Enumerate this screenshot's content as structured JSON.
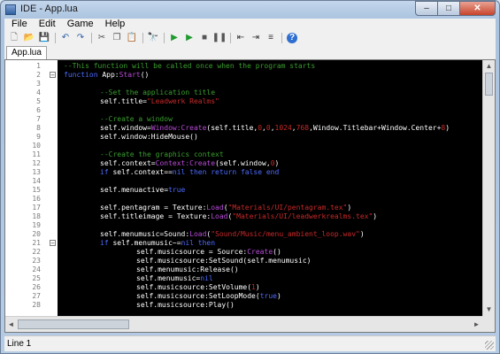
{
  "window": {
    "title": "IDE - App.lua"
  },
  "caption_buttons": {
    "minimize": "–",
    "maximize": "□",
    "close": "✕"
  },
  "menu": [
    "File",
    "Edit",
    "Game",
    "Help"
  ],
  "toolbar": [
    {
      "name": "new-file-icon",
      "glyph": "🗋",
      "color": "#ffffff"
    },
    {
      "name": "open-folder-icon",
      "glyph": "📂",
      "color": "#d7a53a"
    },
    {
      "name": "save-icon",
      "glyph": "💾",
      "color": "#3a5fa8"
    },
    {
      "sep": true
    },
    {
      "name": "undo-icon",
      "glyph": "↶",
      "color": "#2f5fa8"
    },
    {
      "name": "redo-icon",
      "glyph": "↷",
      "color": "#2f5fa8"
    },
    {
      "sep": true
    },
    {
      "name": "cut-icon",
      "glyph": "✂",
      "color": "#555555"
    },
    {
      "name": "copy-icon",
      "glyph": "❐",
      "color": "#555555"
    },
    {
      "name": "paste-icon",
      "glyph": "📋",
      "color": "#b8862b"
    },
    {
      "sep": true
    },
    {
      "name": "find-icon",
      "glyph": "🔭",
      "color": "#333333"
    },
    {
      "sep": true
    },
    {
      "name": "run-icon",
      "glyph": "▶",
      "color": "#1f9a2f"
    },
    {
      "name": "debug-run-icon",
      "glyph": "▶",
      "color": "#1f9a2f"
    },
    {
      "name": "stop-icon",
      "glyph": "■",
      "color": "#555555"
    },
    {
      "name": "pause-icon",
      "glyph": "❚❚",
      "color": "#555555"
    },
    {
      "sep": true
    },
    {
      "name": "outdent-icon",
      "glyph": "⇤",
      "color": "#333333"
    },
    {
      "name": "indent-icon",
      "glyph": "⇥",
      "color": "#333333"
    },
    {
      "name": "comment-icon",
      "glyph": "≡",
      "color": "#333333"
    },
    {
      "sep": true
    },
    {
      "name": "help-icon",
      "glyph": "?",
      "color": "#ffffff",
      "bg": "#2e6fd0"
    }
  ],
  "tabs": [
    "App.lua"
  ],
  "colors": {
    "comment": "#3a9e2e",
    "keyword": "#4d6bff",
    "identifier": "#ffffff",
    "string": "#c82828",
    "function": "#b84bd8",
    "number": "#c82828"
  },
  "code_lines": [
    {
      "n": "1",
      "indent": 0,
      "fold": "",
      "tokens": [
        [
          "cmt",
          "--This function will be called once when the program starts"
        ]
      ]
    },
    {
      "n": "2",
      "indent": 0,
      "fold": "−",
      "tokens": [
        [
          "kw",
          "function "
        ],
        [
          "id",
          "App:"
        ],
        [
          "fn",
          "Start"
        ],
        [
          "id",
          "()"
        ]
      ]
    },
    {
      "n": "3",
      "indent": 0,
      "fold": "",
      "tokens": []
    },
    {
      "n": "4",
      "indent": 1,
      "fold": "",
      "tokens": [
        [
          "cmt",
          "--Set the application title"
        ]
      ]
    },
    {
      "n": "5",
      "indent": 1,
      "fold": "",
      "tokens": [
        [
          "id",
          "self.title="
        ],
        [
          "str",
          "\"Leadwerk Realms\""
        ]
      ]
    },
    {
      "n": "6",
      "indent": 1,
      "fold": "",
      "tokens": []
    },
    {
      "n": "7",
      "indent": 1,
      "fold": "",
      "tokens": [
        [
          "cmt",
          "--Create a window"
        ]
      ]
    },
    {
      "n": "8",
      "indent": 1,
      "fold": "",
      "tokens": [
        [
          "id",
          "self.window="
        ],
        [
          "fn",
          "Window:Create"
        ],
        [
          "id",
          "(self.title,"
        ],
        [
          "num",
          "0"
        ],
        [
          "id",
          ","
        ],
        [
          "num",
          "0"
        ],
        [
          "id",
          ","
        ],
        [
          "num",
          "1024"
        ],
        [
          "id",
          ","
        ],
        [
          "num",
          "768"
        ],
        [
          "id",
          ",Window.Titlebar+Window.Center+"
        ],
        [
          "num",
          "8"
        ],
        [
          "id",
          ")"
        ]
      ]
    },
    {
      "n": "9",
      "indent": 1,
      "fold": "",
      "tokens": [
        [
          "id",
          "self.window:HideMouse()"
        ]
      ]
    },
    {
      "n": "10",
      "indent": 1,
      "fold": "",
      "tokens": []
    },
    {
      "n": "11",
      "indent": 1,
      "fold": "",
      "tokens": [
        [
          "cmt",
          "--Create the graphics context"
        ]
      ]
    },
    {
      "n": "12",
      "indent": 1,
      "fold": "",
      "tokens": [
        [
          "id",
          "self.context="
        ],
        [
          "fn",
          "Context:Create"
        ],
        [
          "id",
          "(self.window,"
        ],
        [
          "num",
          "0"
        ],
        [
          "id",
          ")"
        ]
      ]
    },
    {
      "n": "13",
      "indent": 1,
      "fold": "",
      "tokens": [
        [
          "kw",
          "if "
        ],
        [
          "id",
          "self.context=="
        ],
        [
          "kw",
          "nil then return false end"
        ]
      ]
    },
    {
      "n": "14",
      "indent": 1,
      "fold": "",
      "tokens": []
    },
    {
      "n": "15",
      "indent": 1,
      "fold": "",
      "tokens": [
        [
          "id",
          "self.menuactive="
        ],
        [
          "kw",
          "true"
        ]
      ]
    },
    {
      "n": "16",
      "indent": 1,
      "fold": "",
      "tokens": []
    },
    {
      "n": "17",
      "indent": 1,
      "fold": "",
      "tokens": [
        [
          "id",
          "self.pentagram = Texture:"
        ],
        [
          "fn",
          "Load"
        ],
        [
          "id",
          "("
        ],
        [
          "str",
          "\"Materials/UI/pentagram.tex\""
        ],
        [
          "id",
          ")"
        ]
      ]
    },
    {
      "n": "18",
      "indent": 1,
      "fold": "",
      "tokens": [
        [
          "id",
          "self.titleimage = Texture:"
        ],
        [
          "fn",
          "Load"
        ],
        [
          "id",
          "("
        ],
        [
          "str",
          "\"Materials/UI/leadwerkrealms.tex\""
        ],
        [
          "id",
          ")"
        ]
      ]
    },
    {
      "n": "19",
      "indent": 1,
      "fold": "",
      "tokens": []
    },
    {
      "n": "20",
      "indent": 1,
      "fold": "",
      "tokens": [
        [
          "id",
          "self.menumusic=Sound:"
        ],
        [
          "fn",
          "Load"
        ],
        [
          "id",
          "("
        ],
        [
          "str",
          "\"Sound/Music/menu_ambient_loop.wav\""
        ],
        [
          "id",
          ")"
        ]
      ]
    },
    {
      "n": "21",
      "indent": 1,
      "fold": "−",
      "tokens": [
        [
          "kw",
          "if "
        ],
        [
          "id",
          "self.menumusic~="
        ],
        [
          "kw",
          "nil then"
        ]
      ]
    },
    {
      "n": "22",
      "indent": 2,
      "fold": "",
      "tokens": [
        [
          "id",
          "self.musicsource = Source:"
        ],
        [
          "fn",
          "Create"
        ],
        [
          "id",
          "()"
        ]
      ]
    },
    {
      "n": "23",
      "indent": 2,
      "fold": "",
      "tokens": [
        [
          "id",
          "self.musicsource:SetSound(self.menumusic)"
        ]
      ]
    },
    {
      "n": "24",
      "indent": 2,
      "fold": "",
      "tokens": [
        [
          "id",
          "self.menumusic:Release()"
        ]
      ]
    },
    {
      "n": "25",
      "indent": 2,
      "fold": "",
      "tokens": [
        [
          "id",
          "self.menumusic="
        ],
        [
          "kw",
          "nil"
        ]
      ]
    },
    {
      "n": "26",
      "indent": 2,
      "fold": "",
      "tokens": [
        [
          "id",
          "self.musicsource:SetVolume("
        ],
        [
          "num",
          "1"
        ],
        [
          "id",
          ")"
        ]
      ]
    },
    {
      "n": "27",
      "indent": 2,
      "fold": "",
      "tokens": [
        [
          "id",
          "self.musicsource:SetLoopMode("
        ],
        [
          "kw",
          "true"
        ],
        [
          "id",
          ")"
        ]
      ]
    },
    {
      "n": "28",
      "indent": 2,
      "fold": "",
      "tokens": [
        [
          "id",
          "self.musicsource:Play()"
        ]
      ]
    }
  ],
  "scrollbars": {
    "up": "▲",
    "down": "▼",
    "left": "◄",
    "right": "►"
  },
  "status": {
    "text": "Line 1"
  }
}
